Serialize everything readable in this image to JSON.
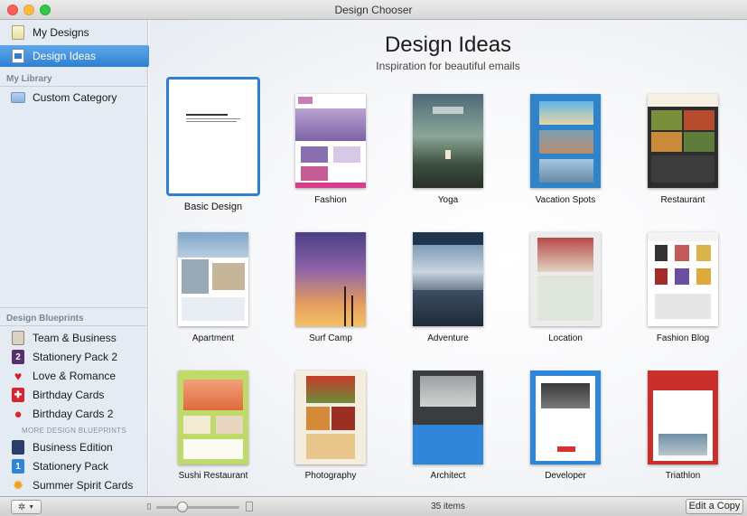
{
  "window": {
    "title": "Design Chooser"
  },
  "sidebar": {
    "top_items": [
      {
        "label": "My Designs",
        "icon": "my-designs-icon"
      },
      {
        "label": "Design Ideas",
        "icon": "design-ideas-icon",
        "selected": true
      }
    ],
    "library_header": "My Library",
    "library_items": [
      {
        "label": "Custom Category",
        "icon": "folder-icon"
      }
    ],
    "blueprints_header": "Design Blueprints",
    "blueprints": [
      {
        "label": "Team & Business",
        "icon": "team-business-icon"
      },
      {
        "label": "Stationery Pack 2",
        "icon": "stationery-pack-2-icon"
      },
      {
        "label": "Love & Romance",
        "icon": "heart-icon"
      },
      {
        "label": "Birthday Cards",
        "icon": "gift-icon"
      },
      {
        "label": "Birthday Cards 2",
        "icon": "balloon-icon"
      }
    ],
    "more_header": "MORE DESIGN BLUEPRINTS",
    "more_items": [
      {
        "label": "Business Edition",
        "icon": "business-edition-icon"
      },
      {
        "label": "Stationery Pack",
        "icon": "stationery-pack-icon"
      },
      {
        "label": "Summer Spirit Cards",
        "icon": "sun-icon"
      }
    ]
  },
  "main": {
    "title": "Design Ideas",
    "subtitle": "Inspiration for beautiful emails",
    "designs": [
      {
        "label": "Basic Design",
        "selected": true
      },
      {
        "label": "Fashion"
      },
      {
        "label": "Yoga"
      },
      {
        "label": "Vacation Spots"
      },
      {
        "label": "Restaurant"
      },
      {
        "label": "Apartment"
      },
      {
        "label": "Surf Camp"
      },
      {
        "label": "Adventure"
      },
      {
        "label": "Location"
      },
      {
        "label": "Fashion Blog"
      },
      {
        "label": "Sushi Restaurant"
      },
      {
        "label": "Photography"
      },
      {
        "label": "Architect"
      },
      {
        "label": "Developer"
      },
      {
        "label": "Triathlon"
      }
    ]
  },
  "bottombar": {
    "gear_icon": "gear-icon",
    "item_count": "35 items",
    "edit_button": "Edit a Copy"
  }
}
